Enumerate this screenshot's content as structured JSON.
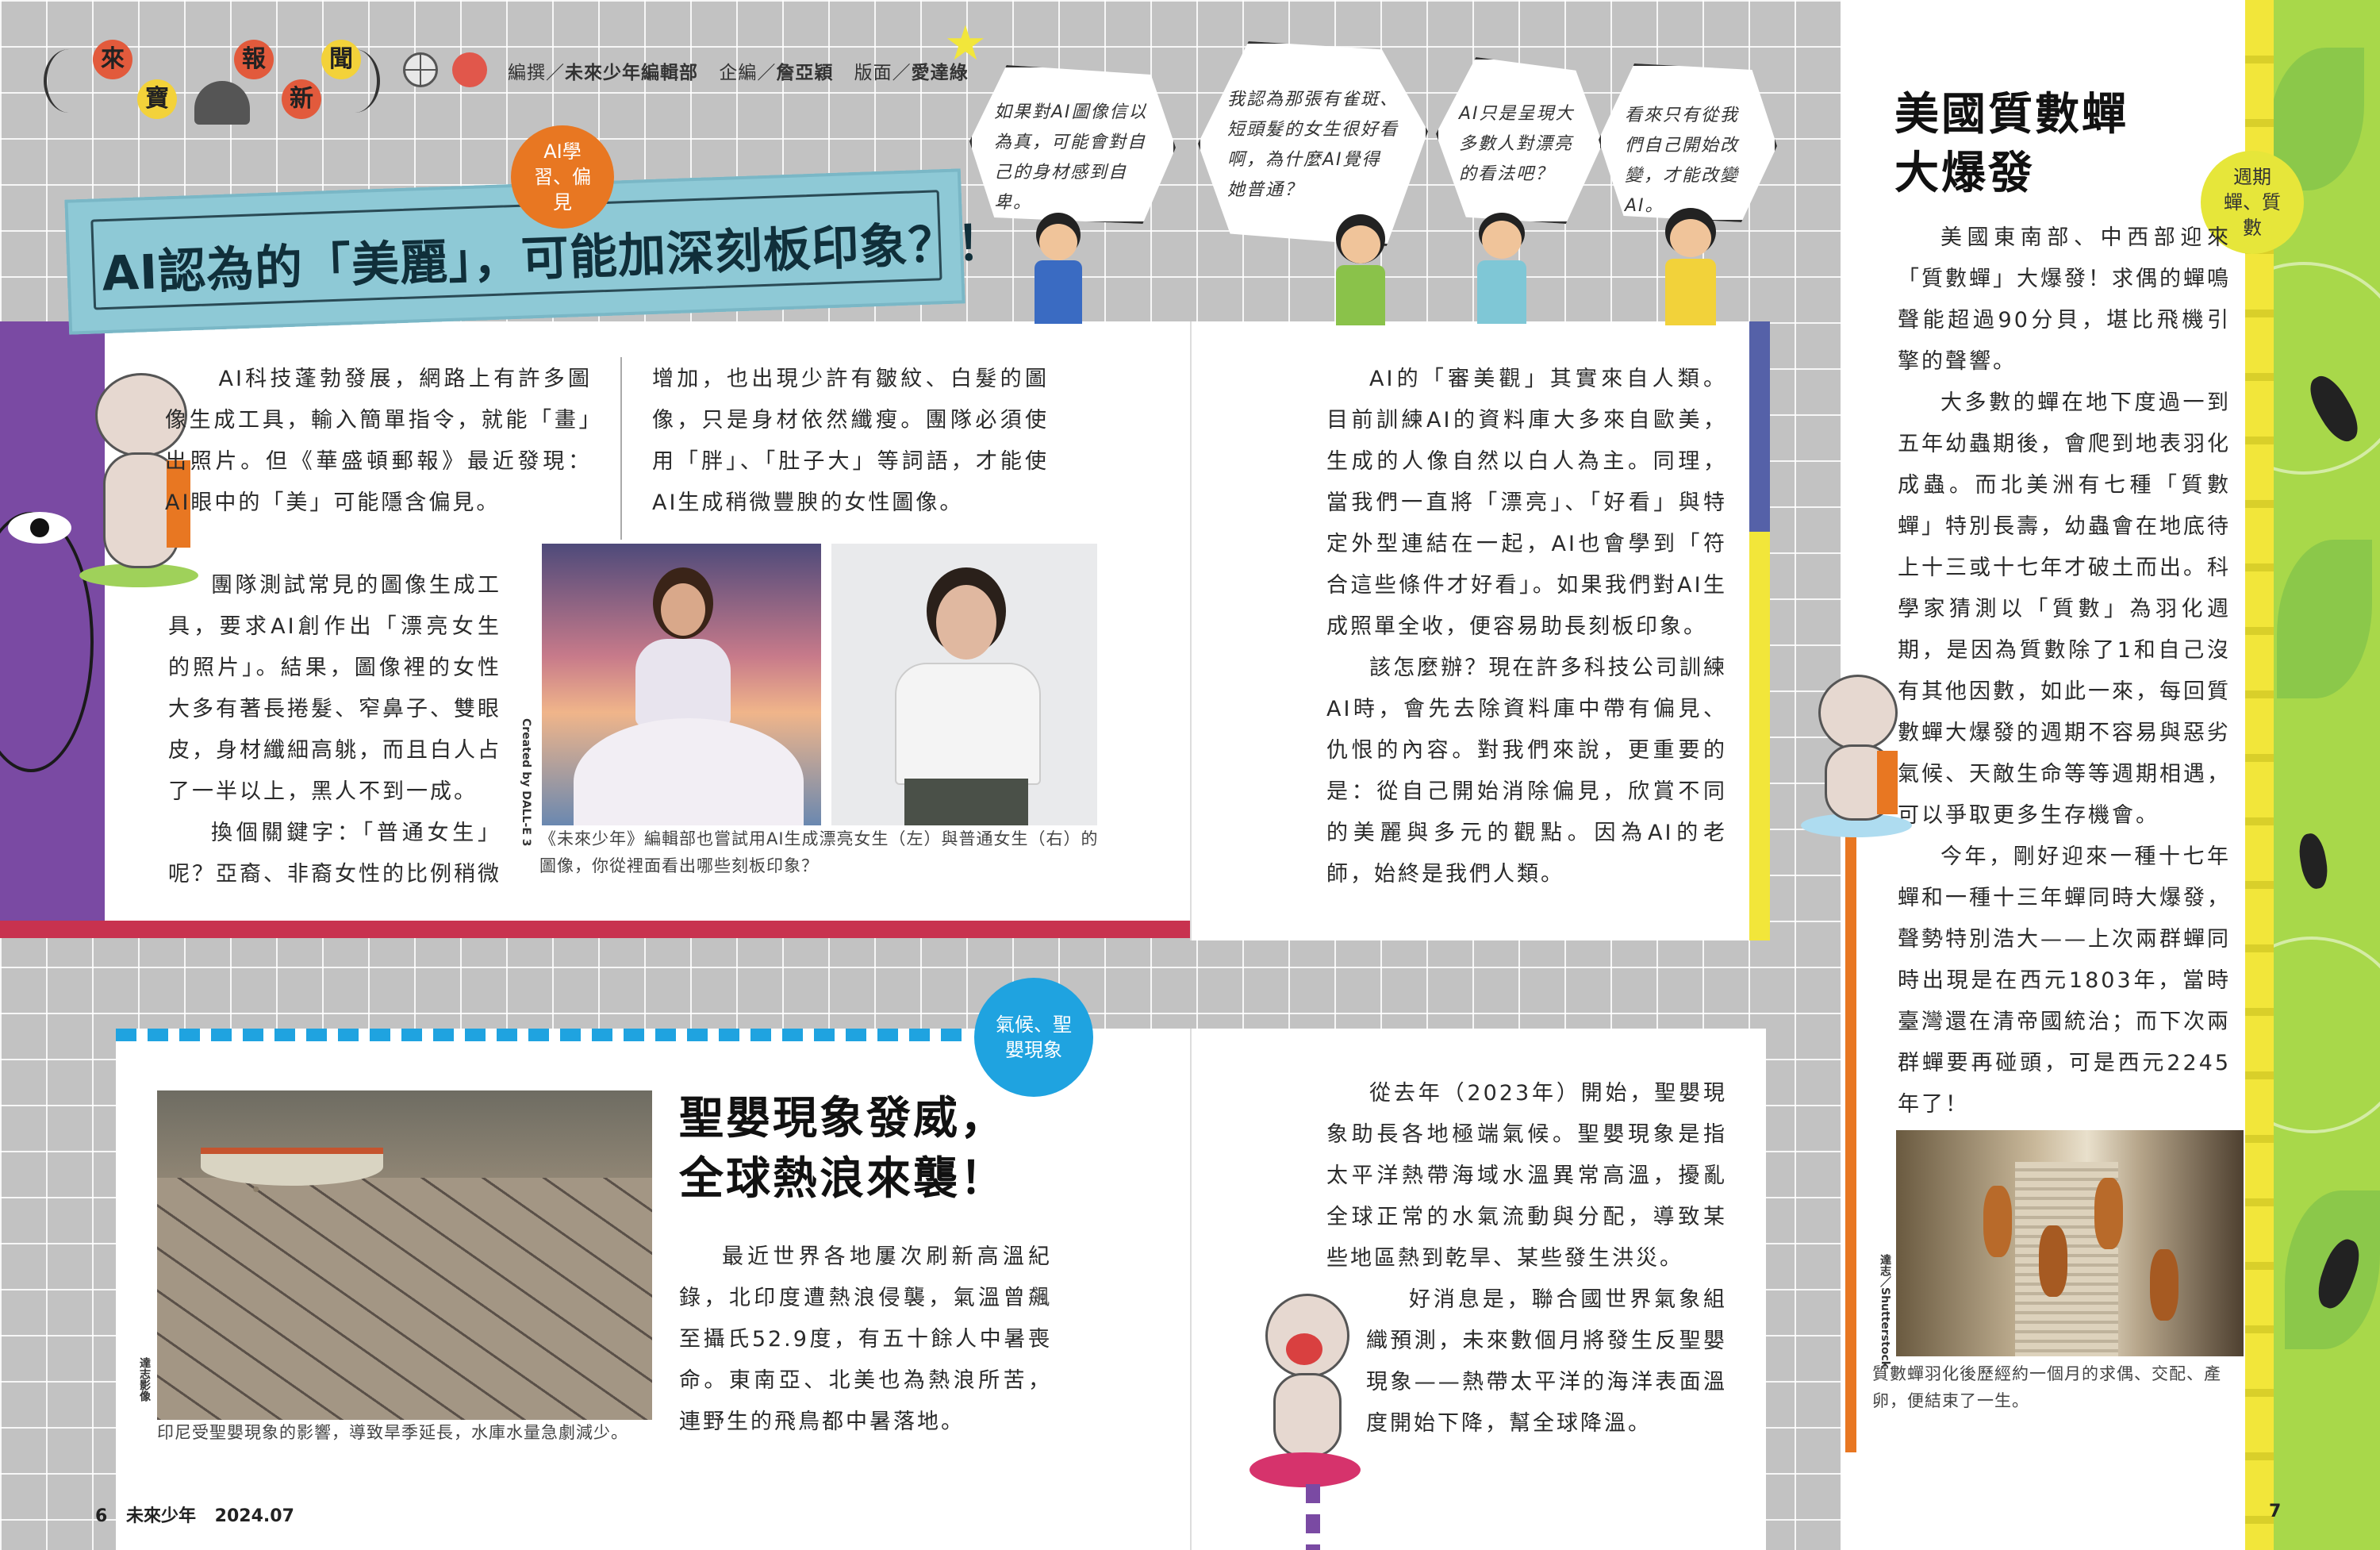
{
  "header": {
    "logo_chars": [
      "來",
      "寶",
      "報",
      "新",
      "聞"
    ],
    "credits": [
      {
        "label": "編撰／",
        "name": "未來少年編輯部"
      },
      {
        "label": "企編／",
        "name": "詹亞穎"
      },
      {
        "label": "版面／",
        "name": "愛達綠"
      }
    ]
  },
  "ai_article": {
    "tag": "AI學習、偏見",
    "title": "AI認為的「美麗」，可能加深刻板印象？！",
    "col1": [
      "AI科技蓬勃發展，網路上有許多圖像生成工具，輸入簡單指令，就能「畫」出照片。但《華盛頓郵報》最近發現：AI眼中的「美」可能隱含偏見。",
      "團隊測試常見的圖像生成工具，要求AI創作出「漂亮女生的照片」。結果，圖像裡的女性大多有著長捲髮、窄鼻子、雙眼皮，身材纖細高䠷，而且白人占了一半以上，黑人不到一成。",
      "換個關鍵字：「普通女生」呢？亞裔、非裔女性的比例稍微"
    ],
    "col2": "增加，也出現少許有皺紋、白髮的圖像，只是身材依然纖瘦。團隊必須使用「胖」、「肚子大」等詞語，才能使AI生成稍微豐腴的女性圖像。",
    "image_credit": "Created by DALL-E 3",
    "caption": "《未來少年》編輯部也嘗試用AI生成漂亮女生（左）與普通女生（右）的圖像，你從裡面看出哪些刻板印象？",
    "col3": [
      "AI的「審美觀」其實來自人類。目前訓練AI的資料庫大多來自歐美，生成的人像自然以白人為主。同理，當我們一直將「漂亮」、「好看」與特定外型連結在一起，AI也會學到「符合這些條件才好看」。如果我們對AI生成照單全收，便容易助長刻板印象。",
      "該怎麼辦？現在許多科技公司訓練AI時，會先去除資料庫中帶有偏見、仇恨的內容。對我們來說，更重要的是：從自己開始消除偏見，欣賞不同的美麗與多元的觀點。因為AI的老師，始終是我們人類。"
    ],
    "bubbles": [
      "如果對AI圖像信以為真，可能會對自己的身材感到自卑。",
      "我認為那張有雀斑、短頭髮的女生很好看啊，為什麼AI覺得她普通？",
      "AI只是呈現大多數人對漂亮的看法吧？",
      "看來只有從我們自己開始改變，才能改變AI。"
    ]
  },
  "cicada_article": {
    "tag": "週期蟬、質數",
    "title_line1": "美國質數蟬",
    "title_line2": "大爆發",
    "paragraphs": [
      "美國東南部、中西部迎來「質數蟬」大爆發！求偶的蟬鳴聲能超過90分貝，堪比飛機引擎的聲響。",
      "大多數的蟬在地下度過一到五年幼蟲期後，會爬到地表羽化成蟲。而北美洲有七種「質數蟬」特別長壽，幼蟲會在地底待上十三或十七年才破土而出。科學家猜測以「質數」為羽化週期，是因為質數除了1和自己沒有其他因數，如此一來，每回質數蟬大爆發的週期不容易與惡劣氣候、天敵生命等等週期相遇，可以爭取更多生存機會。",
      "今年，剛好迎來一種十七年蟬和一種十三年蟬同時大爆發，聲勢特別浩大——上次兩群蟬同時出現是在西元1803年，當時臺灣還在清帝國統治；而下次兩群蟬要再碰頭，可是西元2245年了！"
    ],
    "image_credit": "達志／Shutterstock",
    "caption": "質數蟬羽化後歷經約一個月的求偶、交配、產卵，便結束了一生。"
  },
  "elnino_article": {
    "tag": "氣候、聖嬰現象",
    "title_line1": "聖嬰現象發威，",
    "title_line2": "全球熱浪來襲！",
    "col1": "最近世界各地屢次刷新高溫紀錄，北印度遭熱浪侵襲，氣溫曾飆至攝氏52.9度，有五十餘人中暑喪命。東南亞、北美也為熱浪所苦，連野生的飛鳥都中暑落地。",
    "col2": [
      "從去年（2023年）開始，聖嬰現象助長各地極端氣候。聖嬰現象是指太平洋熱帶海域水溫異常高溫，擾亂全球正常的水氣流動與分配，導致某些地區熱到乾旱、某些發生洪災。",
      "好消息是，聯合國世界氣象組織預測，未來數個月將發生反聖嬰現象——熱帶太平洋的海洋表面溫度開始下降，幫全球降溫。"
    ],
    "image_credit": "達志影像",
    "caption": "印尼受聖嬰現象的影響，導致旱季延長，水庫水量急劇減少。"
  },
  "footer": {
    "left_page": "6",
    "magazine": "未來少年",
    "issue": "2024.07",
    "right_page": "7"
  },
  "colors": {
    "teal_banner": "#8ec9d6",
    "orange_tag": "#e87722",
    "blue_tag": "#1fa3e0",
    "yellow_tag": "#e6e63a",
    "red_stripe": "#c8324f",
    "purple_panel": "#7a4aa3",
    "green_panel": "#a8d84a"
  }
}
